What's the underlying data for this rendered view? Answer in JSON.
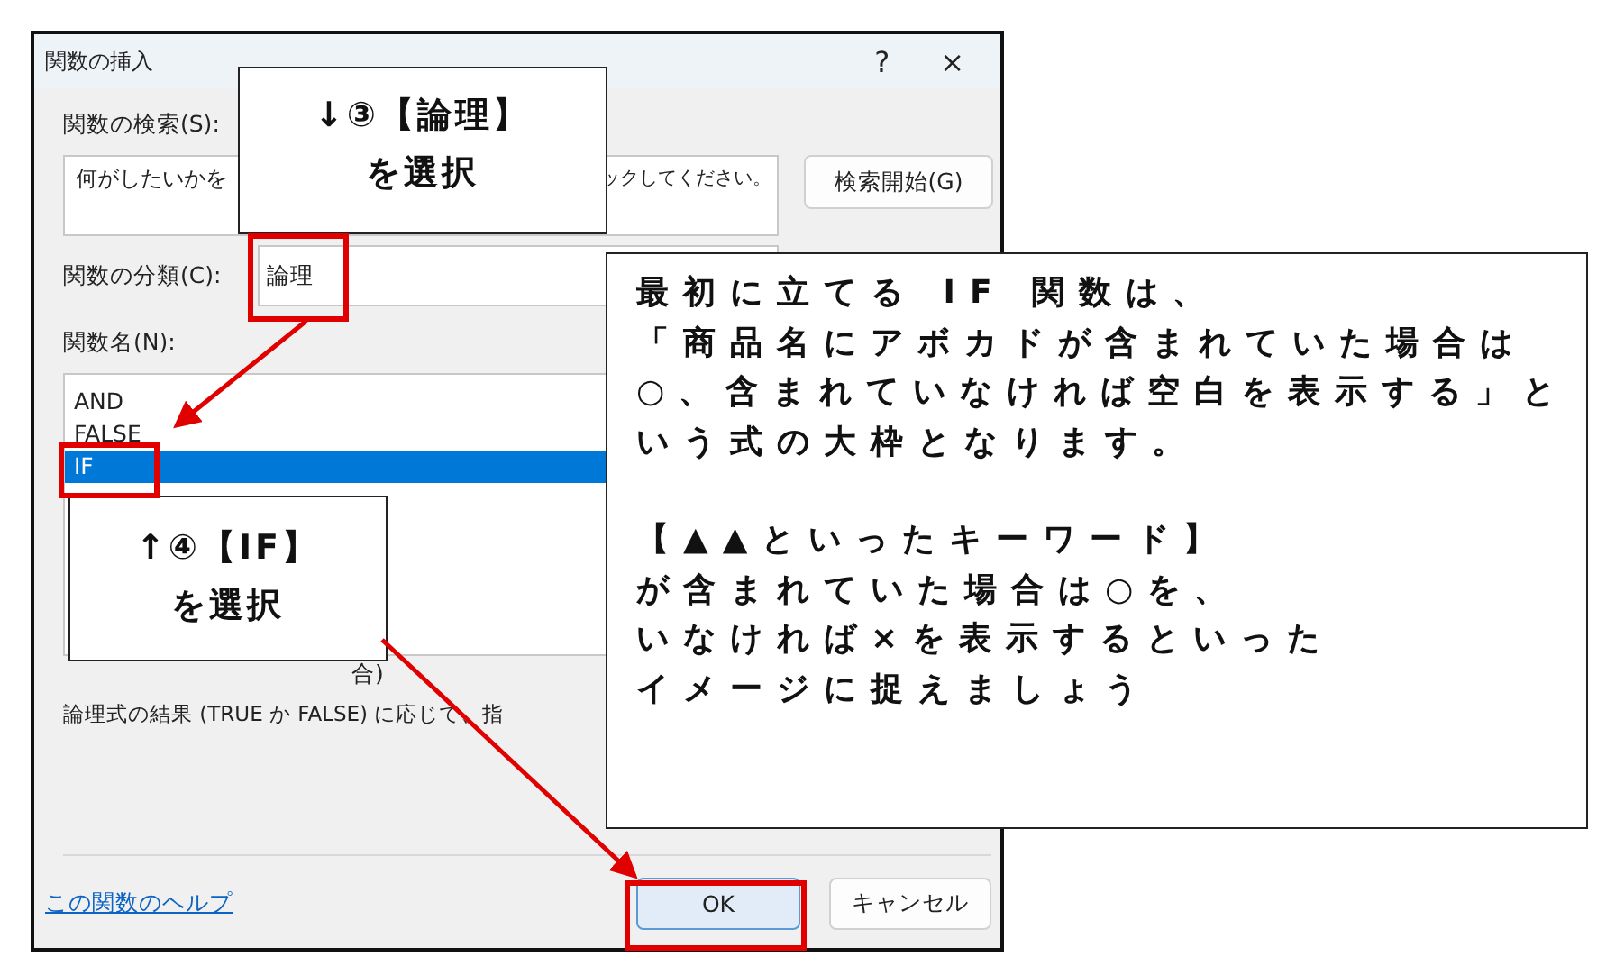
{
  "dialog": {
    "title": "関数の挿入",
    "help_button": "?",
    "close_button": "×",
    "search_label": "関数の検索(S):",
    "search_field": {
      "value_start": "何がしたいかを",
      "value_end": "ックしてください。"
    },
    "search_button": "検索開始(G)",
    "category_label": "関数の分類(C):",
    "category_value": "論理",
    "names_label": "関数名(N):",
    "functions": [
      {
        "name": "AND",
        "selected": false
      },
      {
        "name": "FALSE",
        "selected": false
      },
      {
        "name": "IF",
        "selected": true
      }
    ],
    "syntax": "合)",
    "description": "論理式の結果 (TRUE か FALSE) に応じて、指",
    "help_link": "この関数のヘルプ",
    "ok_button": "OK",
    "cancel_button": "キャンセル"
  },
  "callouts": [
    {
      "kind": "step",
      "lines": [
        "↓③【論理】",
        "を選択"
      ]
    },
    {
      "kind": "step",
      "lines": [
        "↑④【IF】",
        "を選択"
      ]
    },
    {
      "kind": "note",
      "paragraphs": [
        [
          "最初に立てる IF 関数は、",
          "「商品名にアボカドが含まれていた場合は",
          "○、含まれていなければ空白を表示する」と",
          "いう式の大枠となります。"
        ],
        [
          "【▲▲といったキーワード】",
          "が含まれていた場合は○を、",
          "いなければ×を表示するといった",
          "イメージに捉えましょう"
        ]
      ]
    }
  ]
}
